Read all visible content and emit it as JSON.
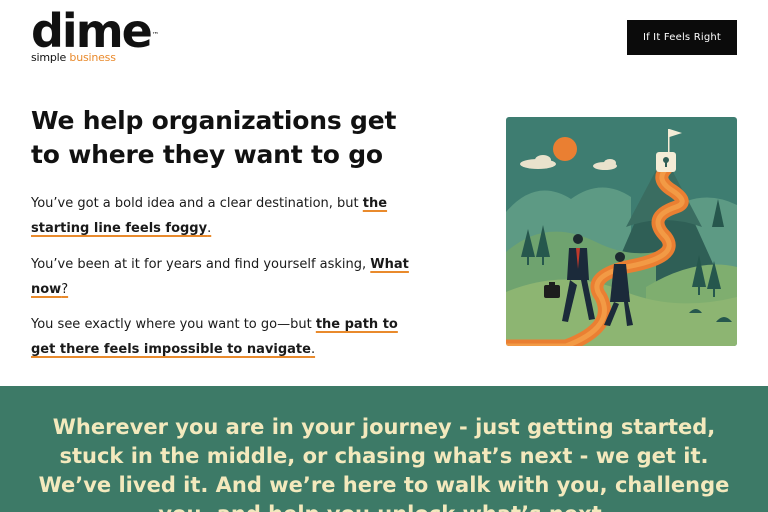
{
  "logo": {
    "word": "dime",
    "trademark": "™",
    "tagline_plain": "simple ",
    "tagline_accent": "business"
  },
  "header": {
    "cta_label": "If It Feels Right"
  },
  "hero": {
    "headline": "We help organizations get to where they want to go",
    "paragraphs": [
      {
        "before": "You’ve got a bold idea and a clear destination, but ",
        "highlight": "the starting line feels foggy",
        "after": "."
      },
      {
        "before": "You’ve been at it for years and find yourself asking, ",
        "highlight": "What now",
        "after": "?"
      },
      {
        "before": "You see exactly where you want to go—but ",
        "highlight": "the path to get there feels impossible to navigate",
        "after": "."
      }
    ]
  },
  "illustration": {
    "icon": "journey-illustration"
  },
  "band": {
    "text": "Wherever you are in your journey - just getting started, stuck in the middle, or chasing what’s next - we get it. We’ve lived it. And we’re here to walk with you, challenge you, and help you unlock what’s next."
  },
  "colors": {
    "accent": "#e98a2c",
    "band_bg": "#3d7a67",
    "band_text": "#f3e9bd",
    "button_bg": "#0b0b0b"
  }
}
